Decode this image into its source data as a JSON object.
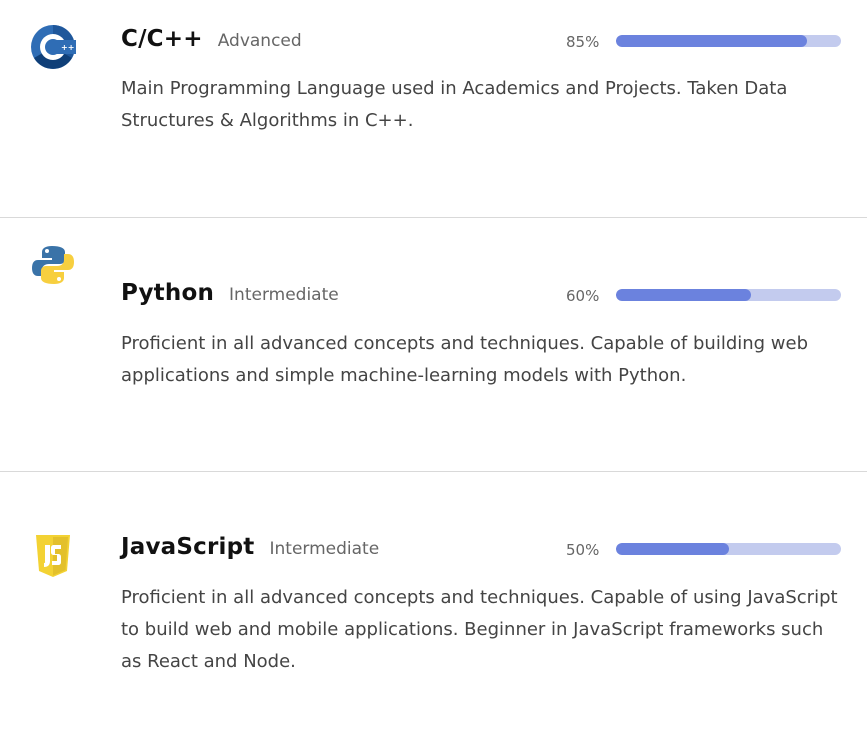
{
  "skills": [
    {
      "name": "C/C++",
      "level": "Advanced",
      "percent_label": "85%",
      "percent": 85,
      "description": "Main Programming Language used in Academics and Projects. Taken Data Structures & Algorithms in C++.",
      "icon": "cpp-logo-icon",
      "colors": {
        "primary": "#2f6db5",
        "dark": "#0f3f78"
      }
    },
    {
      "name": "Python",
      "level": "Intermediate",
      "percent_label": "60%",
      "percent": 60,
      "description": "Proficient in all advanced concepts and techniques. Capable of building web applications and simple machine-learning models with Python.",
      "icon": "python-logo-icon",
      "colors": {
        "primary": "#3a73a8",
        "secondary": "#f7cf3f"
      }
    },
    {
      "name": "JavaScript",
      "level": "Intermediate",
      "percent_label": "50%",
      "percent": 50,
      "description": "Proficient in all advanced concepts and techniques. Capable of using JavaScript to build web and mobile applications. Beginner in JavaScript frameworks such as React and Node.",
      "icon": "js-logo-icon",
      "colors": {
        "primary": "#f3d233",
        "dark": "#d8b42d"
      }
    }
  ],
  "colors": {
    "bar_fill": "#6b82de",
    "bar_track": "#c3cbee",
    "divider": "#d9d9d9"
  }
}
